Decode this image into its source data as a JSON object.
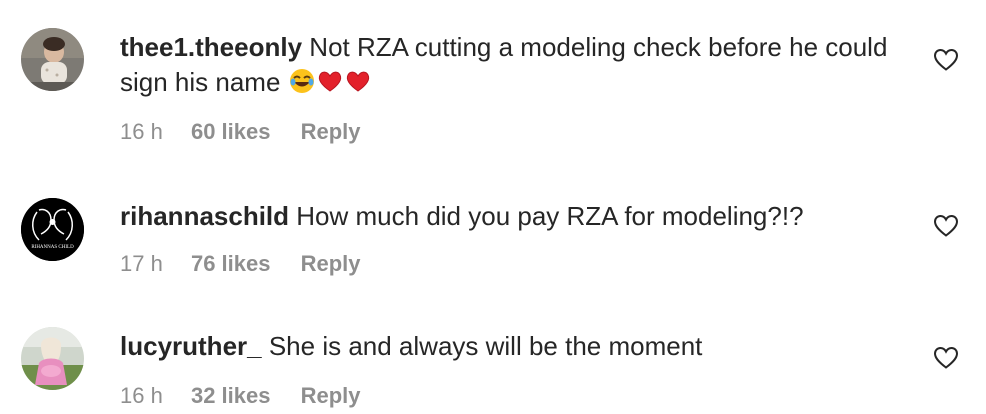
{
  "comments": [
    {
      "username": "thee1.theeonly",
      "text": "Not RZA cutting a modeling check before he could sign his name",
      "emoji": [
        "face-with-tears-of-joy",
        "red-heart",
        "red-heart"
      ],
      "time": "16 h",
      "likes": "60 likes",
      "reply": "Reply",
      "like_icon": "heart-outline-icon"
    },
    {
      "username": "rihannaschild",
      "text": "How much did you pay RZA for modeling?!?",
      "avatar_text": "RIHANNAS CHILD",
      "time": "17 h",
      "likes": "76 likes",
      "reply": "Reply",
      "like_icon": "heart-outline-icon"
    },
    {
      "username": "lucyruther_",
      "text": "She is and always will be the moment",
      "time": "16 h",
      "likes": "32 likes",
      "reply": "Reply",
      "like_icon": "heart-outline-icon"
    }
  ],
  "colors": {
    "text": "#262626",
    "secondary": "#8e8e8e",
    "heart_red": "#e0245e"
  }
}
